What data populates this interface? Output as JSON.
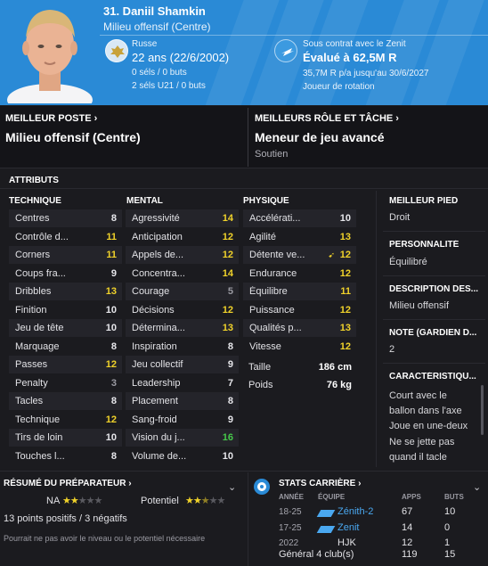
{
  "header": {
    "name": "31. Daniil Shamkin",
    "role": "Milieu offensif (Centre)",
    "nationality": "Russe",
    "age": "22 ans (22/6/2002)",
    "caps": "0 séls / 0 buts",
    "u21_caps": "2 séls U21 / 0 buts",
    "contract": "Sous contrat avec le Zenit",
    "value": "Évalué à 62,5M R",
    "wage": "35,7M R p/a jusqu'au 30/6/2027",
    "squad_status": "Joueur de rotation",
    "accent_color": "#2a8ad6"
  },
  "best_position": {
    "title": "MEILLEUR POSTE",
    "value": "Milieu offensif (Centre)"
  },
  "best_role": {
    "title": "MEILLEURS RÔLE ET TÂCHE",
    "value": "Meneur de jeu avancé",
    "duty": "Soutien"
  },
  "attributes": {
    "title": "ATTRIBUTS",
    "technical_title": "TECHNIQUE",
    "mental_title": "MENTAL",
    "physical_title": "PHYSIQUE",
    "technical": [
      {
        "name": "Centres",
        "value": "8"
      },
      {
        "name": "Contrôle d...",
        "value": "11"
      },
      {
        "name": "Corners",
        "value": "11"
      },
      {
        "name": "Coups fra...",
        "value": "9"
      },
      {
        "name": "Dribbles",
        "value": "13"
      },
      {
        "name": "Finition",
        "value": "10"
      },
      {
        "name": "Jeu de tête",
        "value": "10"
      },
      {
        "name": "Marquage",
        "value": "8"
      },
      {
        "name": "Passes",
        "value": "12"
      },
      {
        "name": "Penalty",
        "value": "3"
      },
      {
        "name": "Tacles",
        "value": "8"
      },
      {
        "name": "Technique",
        "value": "12"
      },
      {
        "name": "Tirs de loin",
        "value": "10"
      },
      {
        "name": "Touches l...",
        "value": "8"
      }
    ],
    "mental": [
      {
        "name": "Agressivité",
        "value": "14"
      },
      {
        "name": "Anticipation",
        "value": "12"
      },
      {
        "name": "Appels de...",
        "value": "12"
      },
      {
        "name": "Concentra...",
        "value": "14"
      },
      {
        "name": "Courage",
        "value": "5"
      },
      {
        "name": "Décisions",
        "value": "12"
      },
      {
        "name": "Détermina...",
        "value": "13"
      },
      {
        "name": "Inspiration",
        "value": "8"
      },
      {
        "name": "Jeu collectif",
        "value": "9"
      },
      {
        "name": "Leadership",
        "value": "7"
      },
      {
        "name": "Placement",
        "value": "8"
      },
      {
        "name": "Sang-froid",
        "value": "9"
      },
      {
        "name": "Vision du j...",
        "value": "16"
      },
      {
        "name": "Volume de...",
        "value": "10"
      }
    ],
    "physical": [
      {
        "name": "Accélérati...",
        "value": "10"
      },
      {
        "name": "Agilité",
        "value": "13"
      },
      {
        "name": "Détente ve...",
        "value": "12"
      },
      {
        "name": "Endurance",
        "value": "12"
      },
      {
        "name": "Équilibre",
        "value": "11"
      },
      {
        "name": "Puissance",
        "value": "12"
      },
      {
        "name": "Qualités p...",
        "value": "13"
      },
      {
        "name": "Vitesse",
        "value": "12"
      }
    ],
    "height_label": "Taille",
    "height": "186 cm",
    "weight_label": "Poids",
    "weight": "76 kg"
  },
  "side": {
    "foot_title": "MEILLEUR PIED",
    "foot": "Droit",
    "personality_title": "PERSONNALITÉ",
    "personality": "Équilibré",
    "description_title": "DESCRIPTION DES...",
    "description": "Milieu offensif",
    "gk_title": "NOTE (GARDIEN D...",
    "gk_value": "2",
    "traits_title": "CARACTÉRISTIQU...",
    "traits": [
      "Court avec le",
      "ballon dans l'axe",
      "Joue en une-deux",
      "Ne se jette pas",
      "quand il tacle"
    ]
  },
  "coach": {
    "title": "RÉSUMÉ DU PRÉPARATEUR",
    "ca_label": "NA",
    "ca_stars": 2,
    "pa_label": "Potentiel",
    "pa_stars": 2.5,
    "summary": "13 points positifs / 3 négatifs",
    "note": "Pourrait ne pas avoir le niveau ou le potentiel nécessaire"
  },
  "career": {
    "title": "STATS CARRIÈRE",
    "headers": {
      "year": "ANNÉE",
      "team": "ÉQUIPE",
      "apps": "APPS",
      "goals": "BUTS"
    },
    "rows": [
      {
        "year": "18-25",
        "team": "Zénith-2",
        "apps": "67",
        "goals": "10"
      },
      {
        "year": "17-25",
        "team": "Zenit",
        "apps": "14",
        "goals": "0"
      },
      {
        "year": "2022",
        "team": "HJK",
        "apps": "12",
        "goals": "1"
      }
    ],
    "total": {
      "label": "Général 4 club(s)",
      "apps": "119",
      "goals": "15"
    }
  }
}
